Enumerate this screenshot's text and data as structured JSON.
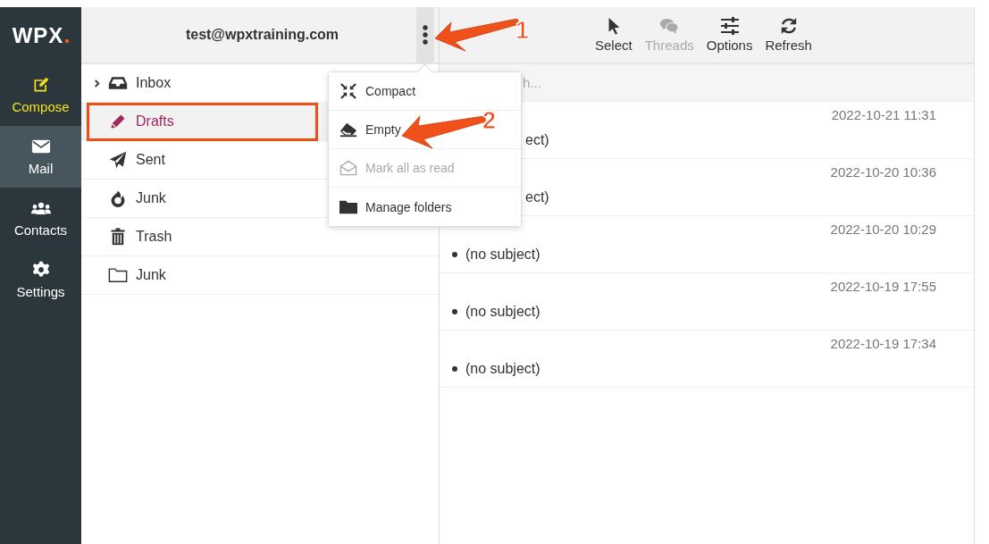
{
  "sidebar": {
    "logo": "WPX",
    "items": [
      {
        "label": "Compose",
        "kind": "compose",
        "selected": false
      },
      {
        "label": "Mail",
        "kind": "mail",
        "selected": true
      },
      {
        "label": "Contacts",
        "kind": "contacts",
        "selected": false
      },
      {
        "label": "Settings",
        "kind": "settings",
        "selected": false
      }
    ]
  },
  "account": {
    "email": "test@wpxtraining.com"
  },
  "folders": [
    {
      "label": "Inbox",
      "kind": "inbox",
      "expanded": false,
      "selected": false,
      "annotated": false
    },
    {
      "label": "Drafts",
      "kind": "drafts",
      "selected": true,
      "annotated": true
    },
    {
      "label": "Sent",
      "kind": "sent",
      "selected": false,
      "annotated": false
    },
    {
      "label": "Junk",
      "kind": "junk",
      "selected": false,
      "annotated": false
    },
    {
      "label": "Trash",
      "kind": "trash",
      "selected": false,
      "annotated": false
    },
    {
      "label": "Junk",
      "kind": "folder",
      "selected": false,
      "annotated": false
    }
  ],
  "folder_menu": [
    {
      "label": "Compact",
      "kind": "compact",
      "disabled": false
    },
    {
      "label": "Empty",
      "kind": "empty",
      "disabled": false
    },
    {
      "label": "Mark all as read",
      "kind": "read",
      "disabled": true
    },
    {
      "label": "Manage folders",
      "kind": "manage",
      "disabled": false
    }
  ],
  "toolbar": [
    {
      "label": "Select",
      "kind": "select",
      "disabled": false
    },
    {
      "label": "Threads",
      "kind": "threads",
      "disabled": true
    },
    {
      "label": "Options",
      "kind": "options",
      "disabled": false
    },
    {
      "label": "Refresh",
      "kind": "refresh",
      "disabled": false
    }
  ],
  "search": {
    "placeholder": "h..."
  },
  "messages": [
    {
      "date": "2022-10-21 11:31",
      "subject": "ect)",
      "kind": "partial"
    },
    {
      "date": "2022-10-20 10:36",
      "subject": "ect)",
      "kind": "partial"
    },
    {
      "date": "2022-10-20 10:29",
      "subject": "(no subject)",
      "kind": "full"
    },
    {
      "date": "2022-10-19 17:55",
      "subject": "(no subject)",
      "kind": "full"
    },
    {
      "date": "2022-10-19 17:34",
      "subject": "(no subject)",
      "kind": "full"
    }
  ],
  "annotations": [
    {
      "label": "1"
    },
    {
      "label": "2"
    }
  ]
}
